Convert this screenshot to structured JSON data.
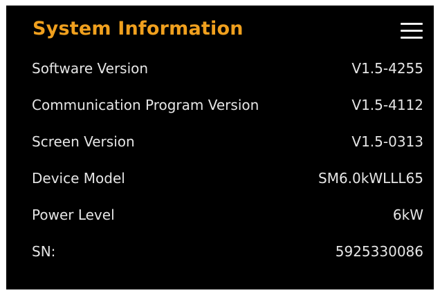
{
  "header": {
    "title": "System Information",
    "menu_icon": "hamburger-menu-icon",
    "title_color": "#f0a01e"
  },
  "info_rows": [
    {
      "label": "Software Version",
      "value": "V1.5-4255"
    },
    {
      "label": "Communication Program Version",
      "value": "V1.5-4112"
    },
    {
      "label": "Screen Version",
      "value": "V1.5-0313"
    },
    {
      "label": "Device Model",
      "value": "SM6.0kWLLL65"
    },
    {
      "label": "Power Level",
      "value": "6kW"
    },
    {
      "label": "SN:",
      "value": "5925330086"
    }
  ]
}
